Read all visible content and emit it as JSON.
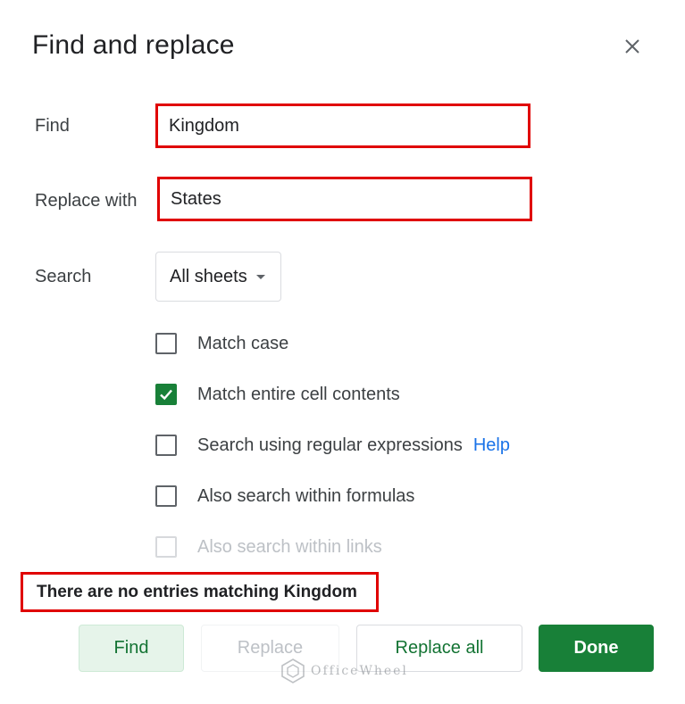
{
  "dialog": {
    "title": "Find and replace",
    "close_icon": "close-icon"
  },
  "find": {
    "label": "Find",
    "value": "Kingdom"
  },
  "replace": {
    "label": "Replace with",
    "value": "States"
  },
  "search": {
    "label": "Search",
    "selected": "All sheets",
    "icon": "chevron-down-icon"
  },
  "options": [
    {
      "label": "Match case",
      "checked": false,
      "disabled": false
    },
    {
      "label": "Match entire cell contents",
      "checked": true,
      "disabled": false
    },
    {
      "label": "Search using regular expressions",
      "checked": false,
      "disabled": false,
      "link": "Help"
    },
    {
      "label": "Also search within formulas",
      "checked": false,
      "disabled": false
    },
    {
      "label": "Also search within links",
      "checked": false,
      "disabled": true
    }
  ],
  "status": "There are no entries matching Kingdom",
  "buttons": {
    "find": "Find",
    "replace": "Replace",
    "replace_all": "Replace all",
    "done": "Done"
  },
  "watermark": "OfficeWheel",
  "colors": {
    "accent_green": "#188038",
    "highlight_red": "#e00000",
    "link_blue": "#1a73e8"
  }
}
